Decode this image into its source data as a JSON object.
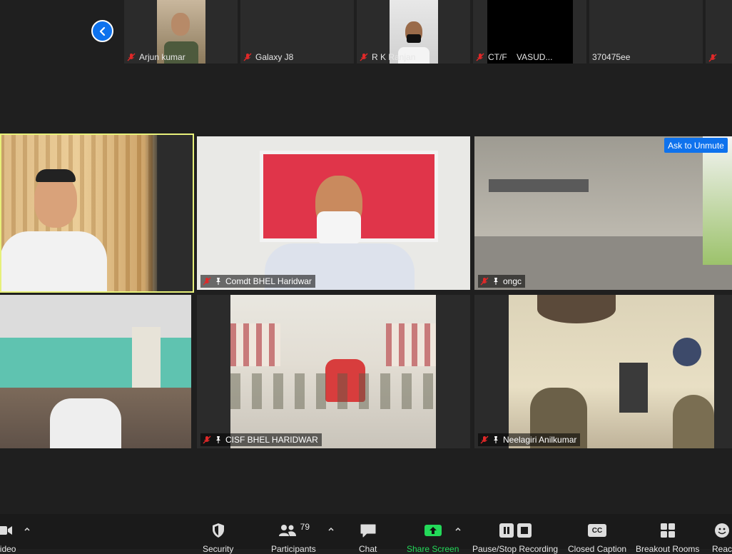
{
  "top_strip": {
    "participants": [
      {
        "name": "Arjun kumar"
      },
      {
        "name": "Galaxy J8"
      },
      {
        "name": "R K Ranjan"
      },
      {
        "name": "CT/F    VASUD..."
      },
      {
        "name": "370475ee"
      },
      {
        "name": ""
      }
    ]
  },
  "grid": {
    "tiles": [
      {
        "name": ""
      },
      {
        "name": "Comdt BHEL Haridwar"
      },
      {
        "name": "ongc"
      },
      {
        "name": ""
      },
      {
        "name": "CISF BHEL HARIDWAR"
      },
      {
        "name": "Neelagiri Anilkumar"
      }
    ],
    "ask_to_unmute": "Ask to Unmute"
  },
  "toolbar": {
    "video": "Video",
    "security": "Security",
    "participants": "Participants",
    "participants_count": "79",
    "chat": "Chat",
    "share_screen": "Share Screen",
    "recording": "Pause/Stop Recording",
    "closed_caption": "Closed Caption",
    "breakout_rooms": "Breakout Rooms",
    "reactions": "Reac",
    "cc_badge": "CC"
  },
  "colors": {
    "accent_blue": "#0e72ed",
    "share_green": "#23d959",
    "active_speaker": "#e7f07a",
    "mute_red": "#e02828"
  }
}
